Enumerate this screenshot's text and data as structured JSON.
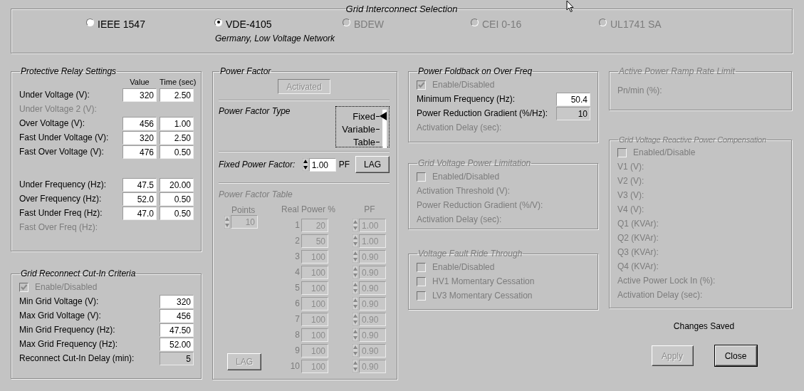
{
  "selection": {
    "title": "Grid Interconnect Selection",
    "standards": [
      {
        "label": "IEEE 1547",
        "selected": false,
        "disabled": false
      },
      {
        "label": "VDE-4105",
        "selected": true,
        "disabled": false
      },
      {
        "label": "BDEW",
        "selected": false,
        "disabled": true
      },
      {
        "label": "CEI 0-16",
        "selected": false,
        "disabled": true
      },
      {
        "label": "UL1741 SA",
        "selected": false,
        "disabled": true
      }
    ],
    "description": "Germany, Low Voltage Network"
  },
  "relay": {
    "title": "Protective Relay Settings",
    "disabled": false,
    "columns": [
      "Value",
      "Time (sec)"
    ],
    "sections": [
      [
        {
          "label": "Under Voltage (V):",
          "disabled": false,
          "fields": [
            {
              "value": "320",
              "locked": false
            },
            {
              "value": "2.50",
              "locked": false
            }
          ]
        },
        {
          "label": "Under Voltage 2 (V):",
          "disabled": true
        },
        {
          "label": "Over Voltage (V):",
          "disabled": false,
          "fields": [
            {
              "value": "456",
              "locked": false
            },
            {
              "value": "1.00",
              "locked": false
            }
          ]
        },
        {
          "label": "Fast Under Voltage (V):",
          "disabled": false,
          "fields": [
            {
              "value": "320",
              "locked": false
            },
            {
              "value": "2.50",
              "locked": false
            }
          ]
        },
        {
          "label": "Fast Over Voltage (V):",
          "disabled": false,
          "fields": [
            {
              "value": "476",
              "locked": false
            },
            {
              "value": "0.50",
              "locked": false
            }
          ]
        }
      ],
      [
        {
          "label": "Under Frequency (Hz):",
          "disabled": false,
          "fields": [
            {
              "value": "47.5",
              "locked": false
            },
            {
              "value": "20.00",
              "locked": false
            }
          ]
        },
        {
          "label": "Over Frequency (Hz):",
          "disabled": false,
          "fields": [
            {
              "value": "52.0",
              "locked": false
            },
            {
              "value": "0.50",
              "locked": false
            }
          ]
        },
        {
          "label": "Fast Under Freq (Hz):",
          "disabled": false,
          "fields": [
            {
              "value": "47.0",
              "locked": false
            },
            {
              "value": "0.50",
              "locked": false
            }
          ]
        },
        {
          "label": "Fast Over Freq (Hz):",
          "disabled": true
        }
      ]
    ]
  },
  "reconnect": {
    "title": "Grid Reconnect Cut-In Criteria",
    "disabled": false,
    "checkboxes": [
      {
        "label": "Enable/Disabled",
        "checked": true,
        "disabled": true
      }
    ],
    "rows": [
      {
        "label": "Min Grid Voltage (V):",
        "disabled": false,
        "fields": [
          {
            "value": "320",
            "locked": false
          }
        ]
      },
      {
        "label": "Max Grid Voltage (V):",
        "disabled": false,
        "fields": [
          {
            "value": "456",
            "locked": false
          }
        ]
      },
      {
        "label": "Min Grid Frequency (Hz):",
        "disabled": false,
        "fields": [
          {
            "value": "47.50",
            "locked": false
          }
        ]
      },
      {
        "label": "Max Grid Frequency (Hz):",
        "disabled": false,
        "fields": [
          {
            "value": "52.00",
            "locked": false
          }
        ]
      },
      {
        "label": "Reconnect Cut-In Delay (min):",
        "disabled": false,
        "fields": [
          {
            "value": "5",
            "locked": true
          }
        ]
      }
    ]
  },
  "power_factor": {
    "title": "Power Factor",
    "toggle": {
      "label": "Activated",
      "disabled": true
    },
    "type": {
      "label": "Power Factor Type",
      "options": [
        {
          "label": "Fixed",
          "selected": true
        },
        {
          "label": "Variable",
          "selected": false
        },
        {
          "label": "Table",
          "selected": false
        }
      ]
    },
    "fixed": {
      "label": "Fixed Power Factor:",
      "value": "1.00",
      "unit": "PF",
      "button": "LAG"
    },
    "table": {
      "title": "Power Factor Table",
      "disabled": true,
      "points_label": "Points",
      "points": "10",
      "columns": [
        "Real Power %",
        "PF"
      ],
      "button": "LAG",
      "rows": [
        {
          "index": "1",
          "power": "20",
          "pf": "1.00"
        },
        {
          "index": "2",
          "power": "50",
          "pf": "1.00"
        },
        {
          "index": "3",
          "power": "100",
          "pf": "0.90"
        },
        {
          "index": "4",
          "power": "100",
          "pf": "0.90"
        },
        {
          "index": "5",
          "power": "100",
          "pf": "0.90"
        },
        {
          "index": "6",
          "power": "100",
          "pf": "0.90"
        },
        {
          "index": "7",
          "power": "100",
          "pf": "0.90"
        },
        {
          "index": "8",
          "power": "100",
          "pf": "0.90"
        },
        {
          "index": "9",
          "power": "100",
          "pf": "0.90"
        },
        {
          "index": "10",
          "power": "100",
          "pf": "0.90"
        }
      ]
    }
  },
  "foldback": {
    "title": "Power Foldback on Over Freq",
    "disabled": false,
    "checkboxes": [
      {
        "label": "Enable/Disabled",
        "checked": true,
        "disabled": true
      }
    ],
    "rows": [
      {
        "label": "Minimum Frequency (Hz):",
        "disabled": false,
        "fields": [
          {
            "value": "50.4",
            "locked": false
          }
        ]
      },
      {
        "label": "Power Reduction Gradient (%/Hz):",
        "disabled": false,
        "fields": [
          {
            "value": "10",
            "locked": true
          }
        ]
      },
      {
        "label": "Activation Delay (sec):",
        "disabled": true
      }
    ]
  },
  "limitation": {
    "title": "Grid Voltage Power Limitation",
    "disabled": true,
    "checkboxes": [
      {
        "label": "Enabled/Disabled",
        "checked": false,
        "disabled": true
      }
    ],
    "rows": [
      {
        "label": "Activation Threshold (V):",
        "disabled": true
      },
      {
        "label": "Power Reduction Gradient (%/V):",
        "disabled": true
      },
      {
        "label": "Activation Delay (sec):",
        "disabled": true
      }
    ]
  },
  "fault_ride_through": {
    "title": "Voltage Fault Ride Through",
    "disabled": true,
    "checkboxes": [
      {
        "label": "Enable/Disabled",
        "checked": false,
        "disabled": true
      },
      {
        "label": "HV1 Momentary Cessation",
        "checked": false,
        "disabled": true
      },
      {
        "label": "LV3 Momentary Cessation",
        "checked": false,
        "disabled": true
      }
    ]
  },
  "ramp_rate": {
    "title": "Active Power Ramp Rate Limit",
    "disabled": true,
    "rows": [
      {
        "label": "Pn/min (%):",
        "disabled": true
      }
    ]
  },
  "reactive": {
    "title": "Grid Voltage Reactive Power Compensation",
    "disabled": true,
    "checkboxes": [
      {
        "label": "Enabled/Disable",
        "checked": false,
        "disabled": true
      }
    ],
    "rows": [
      {
        "label": "V1 (V):",
        "disabled": true
      },
      {
        "label": "V2 (V):",
        "disabled": true
      },
      {
        "label": "V3 (V):",
        "disabled": true
      },
      {
        "label": "V4 (V):",
        "disabled": true
      },
      {
        "label": "Q1 (KVAr):",
        "disabled": true
      },
      {
        "label": "Q2 (KVAr):",
        "disabled": true
      },
      {
        "label": "Q3 (KVAr):",
        "disabled": true
      },
      {
        "label": "Q4 (KVAr):",
        "disabled": true
      },
      {
        "label": "Active Power Lock In (%):",
        "disabled": true
      },
      {
        "label": "Activation Delay (sec):",
        "disabled": true
      }
    ]
  },
  "status": "Changes Saved",
  "buttons": [
    {
      "label": "Apply",
      "disabled": true,
      "default": false
    },
    {
      "label": "Close",
      "disabled": false,
      "default": true
    }
  ]
}
